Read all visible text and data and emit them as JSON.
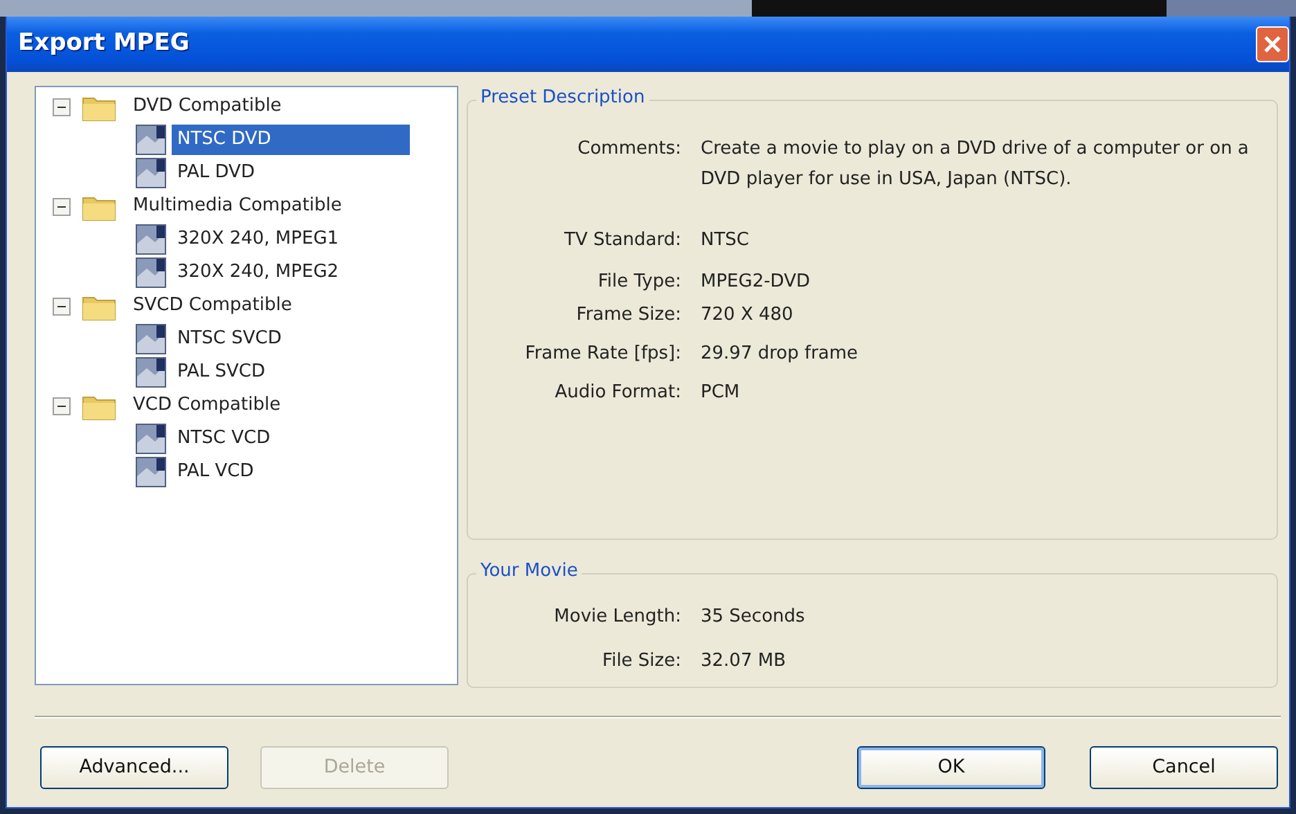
{
  "window": {
    "title": "Export MPEG"
  },
  "presets": [
    {
      "label": "DVD Compatible",
      "expanded": true,
      "children": [
        {
          "label": "NTSC DVD",
          "selected": true
        },
        {
          "label": "PAL DVD",
          "selected": false
        }
      ]
    },
    {
      "label": "Multimedia Compatible",
      "expanded": true,
      "children": [
        {
          "label": "320X 240, MPEG1",
          "selected": false
        },
        {
          "label": "320X 240, MPEG2",
          "selected": false
        }
      ]
    },
    {
      "label": "SVCD Compatible",
      "expanded": true,
      "children": [
        {
          "label": "NTSC SVCD",
          "selected": false
        },
        {
          "label": "PAL SVCD",
          "selected": false
        }
      ]
    },
    {
      "label": "VCD Compatible",
      "expanded": true,
      "children": [
        {
          "label": "NTSC VCD",
          "selected": false
        },
        {
          "label": "PAL VCD",
          "selected": false
        }
      ]
    }
  ],
  "preset_description": {
    "title": "Preset Description",
    "rows": [
      {
        "label": "Comments:",
        "value": "Create a movie to play on a DVD drive of a computer or on a DVD player for use in USA, Japan (NTSC)."
      },
      {
        "label": "TV Standard:",
        "value": "NTSC"
      },
      {
        "label": "File Type:",
        "value": "MPEG2-DVD"
      },
      {
        "label": "Frame Size:",
        "value": "720 X 480"
      },
      {
        "label": "Frame Rate [fps]:",
        "value": "29.97 drop frame"
      },
      {
        "label": "Audio Format:",
        "value": "PCM"
      }
    ]
  },
  "your_movie": {
    "title": "Your Movie",
    "rows": [
      {
        "label": "Movie Length:",
        "value": "35 Seconds"
      },
      {
        "label": "File Size:",
        "value": "32.07 MB"
      }
    ]
  },
  "buttons_left": [
    {
      "label": "Advanced...",
      "disabled": false
    },
    {
      "label": "Delete",
      "disabled": true
    }
  ],
  "buttons_right": [
    {
      "label": "OK",
      "default": true
    },
    {
      "label": "Cancel",
      "default": false
    }
  ]
}
